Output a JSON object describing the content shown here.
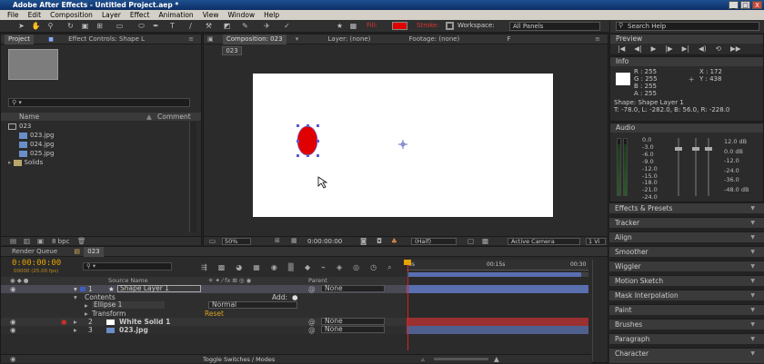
{
  "window": {
    "title": "Adobe After Effects - Untitled Project.aep *",
    "buttons": [
      "_",
      "□",
      "X"
    ]
  },
  "menu": [
    "File",
    "Edit",
    "Composition",
    "Layer",
    "Effect",
    "Animation",
    "View",
    "Window",
    "Help"
  ],
  "toolbar": {
    "fill_label": "Fill:",
    "stroke_label": "Stroke:",
    "workspace_label": "Workspace:",
    "workspace_value": "All Panels",
    "search_help_placeholder": "Search Help",
    "fill_color": "#e00000"
  },
  "project_panel": {
    "tabs": [
      "Project",
      "Effect Controls: Shape L"
    ],
    "search_placeholder": "",
    "columns": [
      "Name",
      "Comment"
    ],
    "items": [
      {
        "name": "023",
        "type": "composition"
      },
      {
        "name": "023.jpg",
        "type": "image"
      },
      {
        "name": "024.jpg",
        "type": "image"
      },
      {
        "name": "025.jpg",
        "type": "image"
      },
      {
        "name": "Solids",
        "type": "folder"
      }
    ],
    "bpc": "8 bpc"
  },
  "comp_panel": {
    "tabs": [
      "Composition: 023",
      "Layer: (none)",
      "Footage: (none)",
      "F"
    ],
    "comp_name_tab": "023",
    "zoom": "50%",
    "timecode": "0:00:00:00",
    "resolution": "(Half)",
    "camera": "Active Camera",
    "views": "1 Vi"
  },
  "info_panel": {
    "title": "Info",
    "r": "R : 255",
    "g": "G : 255",
    "b": "B : 255",
    "a": "A : 255",
    "x": "X : 172",
    "y": "Y : 438",
    "layer": "Shape: Shape Layer 1",
    "transform": "T: -78.0, L: -282.0, B: 56.0, R: -228.0"
  },
  "preview_panel": {
    "title": "Preview"
  },
  "audio_panel": {
    "title": "Audio",
    "left_labels": [
      "0.0",
      "-3.0",
      "-6.0",
      "-9.0",
      "-12.0",
      "-15.0",
      "-18.0",
      "-21.0",
      "-24.0"
    ],
    "right_labels": [
      "12.0 dB",
      "0.0 dB",
      "-12.0",
      "-24.0",
      "-36.0",
      "-48.0 dB"
    ]
  },
  "right_panels": [
    "Effects & Presets",
    "Tracker",
    "Align",
    "Smoother",
    "Wiggler",
    "Motion Sketch",
    "Mask Interpolation",
    "Paint",
    "Brushes",
    "Paragraph",
    "Character"
  ],
  "timeline": {
    "tabs": [
      "Render Queue",
      "023"
    ],
    "timecode": "0:00:00:00",
    "fps": "00000 (25.00 fps)",
    "col_source": "Source Name",
    "col_parent": "Parent",
    "ruler": [
      "0s",
      "00:15s",
      "00:30"
    ],
    "layers": [
      {
        "num": "1",
        "name": "Shape Layer 1",
        "parent": "None",
        "color": "#3f5fbf"
      },
      {
        "num": "",
        "name": "Contents",
        "add": "Add:"
      },
      {
        "num": "",
        "name": "Ellipse 1",
        "mode": "Normal"
      },
      {
        "num": "",
        "name": "Transform",
        "reset": "Reset"
      },
      {
        "num": "2",
        "name": "White Solid 1",
        "parent": "None",
        "color": "#8a2020"
      },
      {
        "num": "3",
        "name": "023.jpg",
        "parent": "None",
        "color": "#3f4f8f"
      }
    ],
    "bottom_label": "Toggle Switches / Modes"
  }
}
